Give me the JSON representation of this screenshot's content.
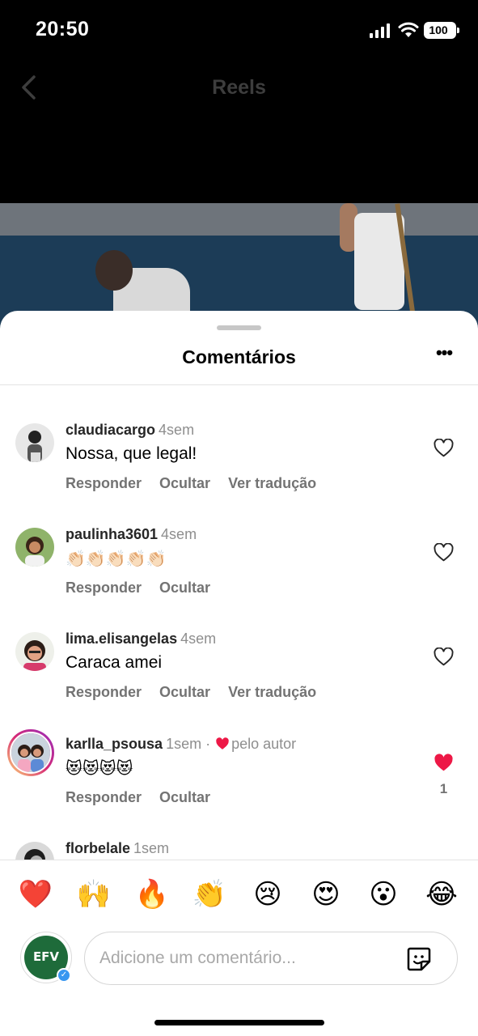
{
  "status_bar": {
    "time": "20:50",
    "battery": "100"
  },
  "header": {
    "title": "Reels",
    "back_icon": "chevron-left-icon"
  },
  "sheet": {
    "title": "Comentários",
    "more_icon": "more-horizontal-icon"
  },
  "comments": [
    {
      "user": "claudiacargo",
      "time": "4sem",
      "text": "Nossa, que legal!",
      "actions": [
        "Responder",
        "Ocultar",
        "Ver tradução"
      ],
      "liked": false
    },
    {
      "user": "paulinha3601",
      "time": "4sem",
      "text": "👏🏻👏🏻👏🏻👏🏻👏🏻",
      "actions": [
        "Responder",
        "Ocultar"
      ],
      "liked": false
    },
    {
      "user": "lima.elisangelas",
      "time": "4sem",
      "text": "Caraca amei",
      "actions": [
        "Responder",
        "Ocultar",
        "Ver tradução"
      ],
      "liked": false
    },
    {
      "user": "karlla_psousa",
      "time": "1sem",
      "separator": "·",
      "author_like": "pelo autor",
      "text": "😻😻😻😻",
      "actions": [
        "Responder",
        "Ocultar"
      ],
      "liked": true,
      "like_count": "1"
    },
    {
      "user": "florbelale",
      "time": "1sem"
    }
  ],
  "emoji_bar": [
    "❤️",
    "🙌",
    "🔥",
    "👏",
    "😢",
    "😍",
    "😮",
    "😂"
  ],
  "composer": {
    "placeholder": "Adicione um comentário...",
    "avatar_text": "EFV",
    "sticker_icon": "sticker-icon"
  },
  "colors": {
    "like_red": "#ed1846",
    "muted": "#737373",
    "verified": "#3897f0"
  }
}
